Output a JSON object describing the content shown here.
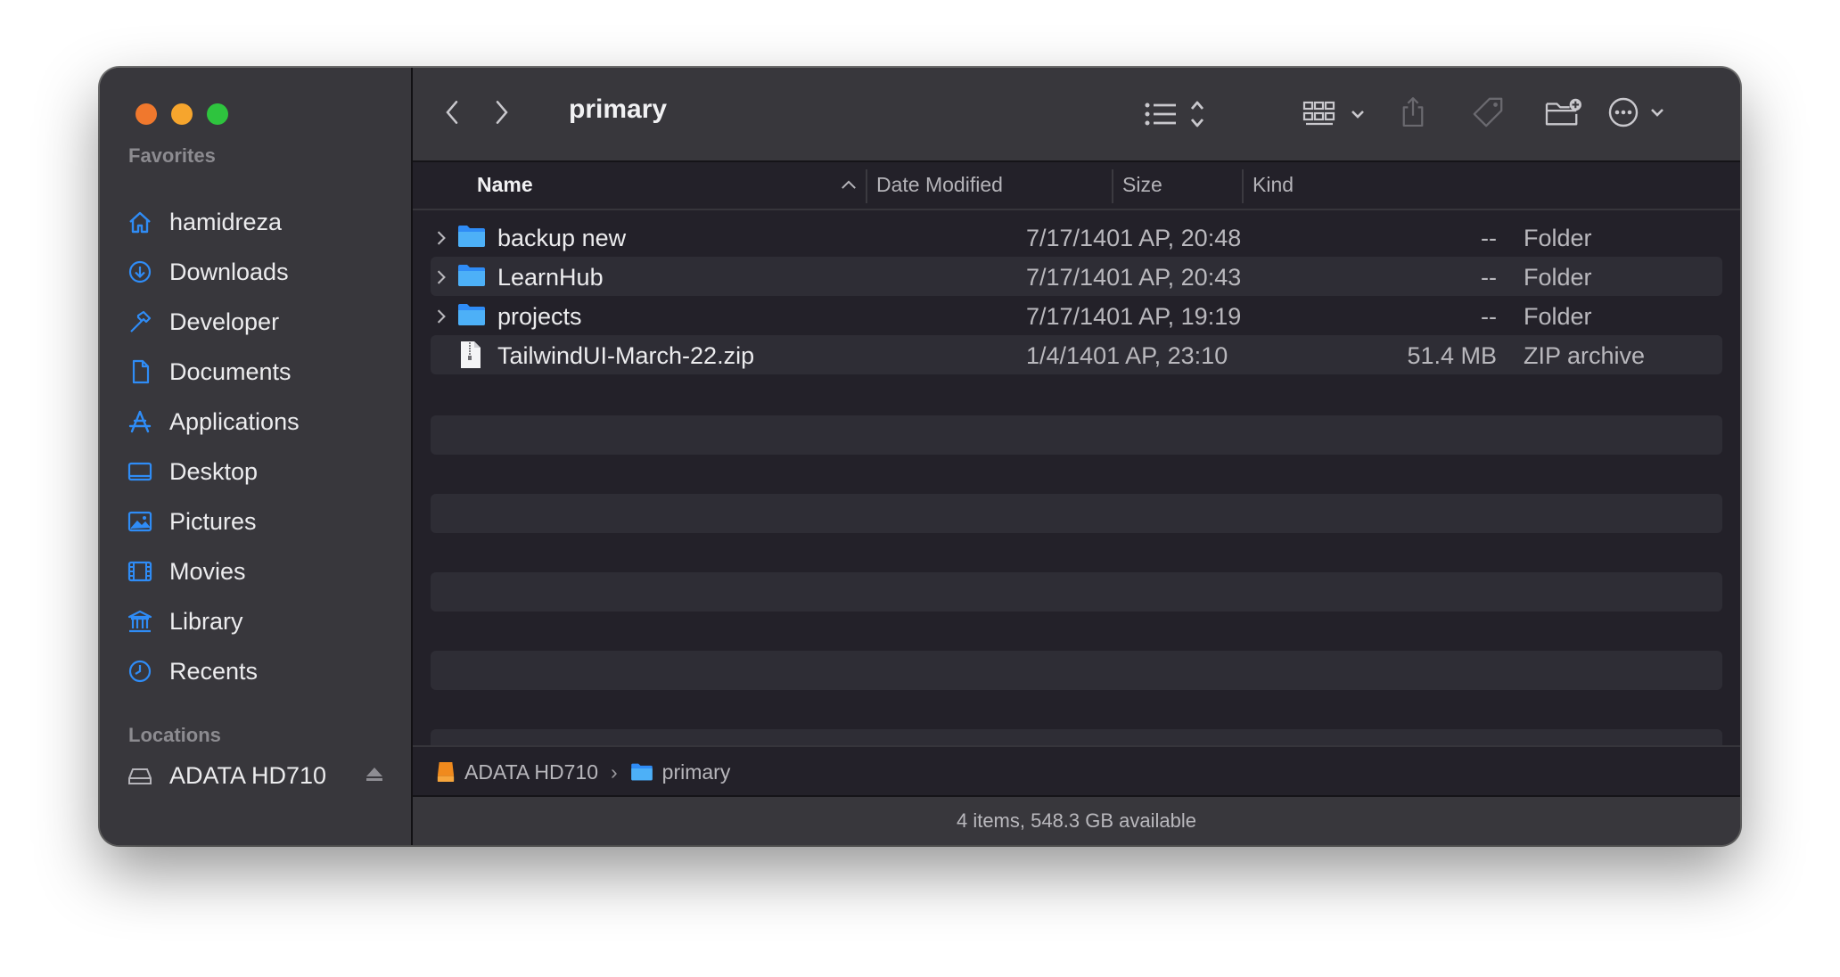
{
  "window": {
    "title": "primary"
  },
  "sidebar": {
    "favorites_heading": "Favorites",
    "items": [
      {
        "label": "hamidreza",
        "icon": "home-icon"
      },
      {
        "label": "Downloads",
        "icon": "download-icon"
      },
      {
        "label": "Developer",
        "icon": "hammer-icon"
      },
      {
        "label": "Documents",
        "icon": "document-icon"
      },
      {
        "label": "Applications",
        "icon": "applications-icon"
      },
      {
        "label": "Desktop",
        "icon": "desktop-icon"
      },
      {
        "label": "Pictures",
        "icon": "picture-icon"
      },
      {
        "label": "Movies",
        "icon": "film-icon"
      },
      {
        "label": "Library",
        "icon": "library-icon"
      },
      {
        "label": "Recents",
        "icon": "clock-icon"
      }
    ],
    "locations_heading": "Locations",
    "device": {
      "label": "ADATA HD710",
      "icon": "drive-icon"
    }
  },
  "columns": {
    "name": "Name",
    "date": "Date Modified",
    "size": "Size",
    "kind": "Kind"
  },
  "files": [
    {
      "name": "backup new",
      "date": "7/17/1401 AP, 20:48",
      "size": "--",
      "kind": "Folder",
      "type": "folder"
    },
    {
      "name": "LearnHub",
      "date": "7/17/1401 AP, 20:43",
      "size": "--",
      "kind": "Folder",
      "type": "folder"
    },
    {
      "name": "projects",
      "date": "7/17/1401 AP, 19:19",
      "size": "--",
      "kind": "Folder",
      "type": "folder"
    },
    {
      "name": "TailwindUI-March-22.zip",
      "date": "1/4/1401 AP, 23:10",
      "size": "51.4 MB",
      "kind": "ZIP archive",
      "type": "zip"
    }
  ],
  "pathbar": {
    "drive": "ADATA HD710",
    "folder": "primary"
  },
  "status": "4 items, 548.3 GB available",
  "colors": {
    "accent": "#2f7ff0",
    "folder": "#38a8f5",
    "close": "#f0782d",
    "minimize": "#f6a52d",
    "maximize": "#2ec43e"
  }
}
